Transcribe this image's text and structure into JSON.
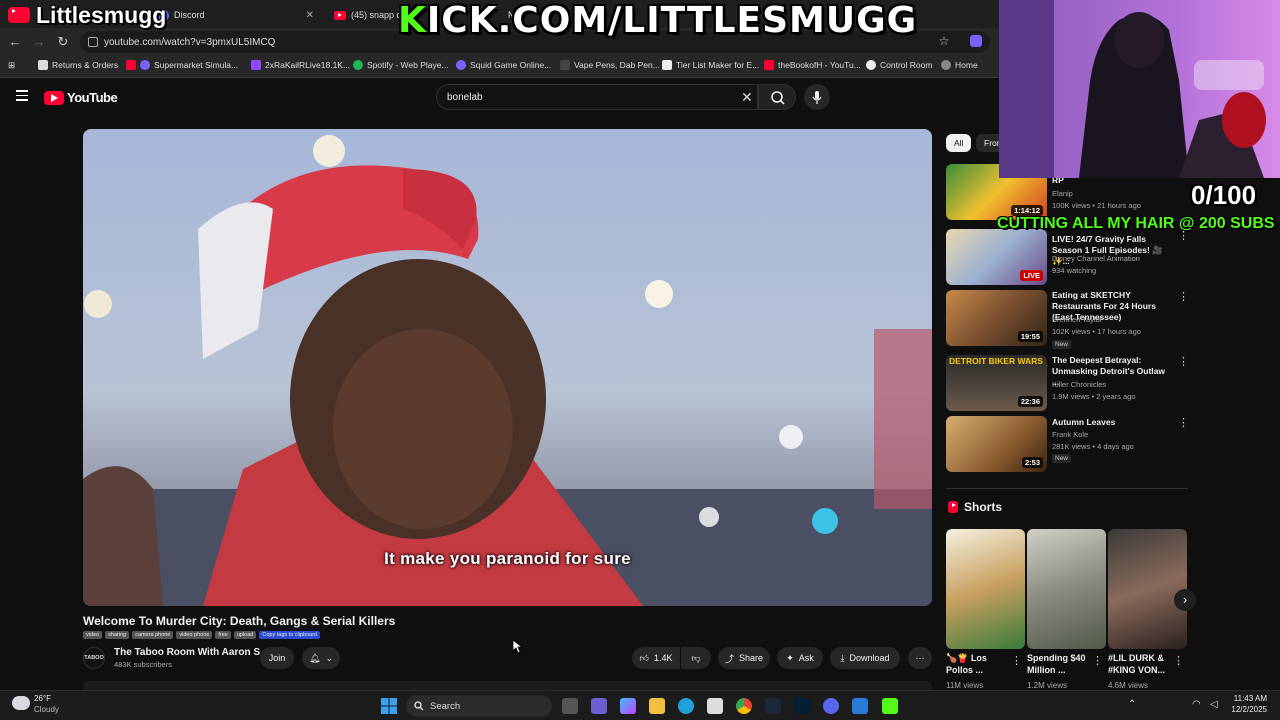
{
  "browser": {
    "tabs": [
      {
        "label": "(45) Littlesmugg"
      },
      {
        "label": "Discord"
      },
      {
        "label": "(45) snapp dog"
      },
      {
        "label": "New"
      }
    ],
    "url": "youtube.com/watch?v=3pmxUL5IMCQ",
    "bookmarks": [
      "Returns & Orders",
      "Supermarket Simula...",
      "2xRaKailRLive18.1K...",
      "Spotify - Web Playe...",
      "Squid Game Online...",
      "Vape Pens, Dab Pen...",
      "Tier List Maker for E...",
      "theBookofH - YouTu...",
      "Control Room",
      "Home"
    ]
  },
  "youtube": {
    "logo_text": "YouTube",
    "search_value": "bonelab"
  },
  "video": {
    "caption": "It make you paranoid for sure",
    "title": "Welcome To Murder City: Death, Gangs & Serial Killers",
    "tags": [
      "video",
      "sharing",
      "camera phone",
      "video phone",
      "free",
      "upload",
      "Copy tags to clipboard"
    ],
    "channel": {
      "avatar_text": "TABOO",
      "name": "The Taboo Room With Aaron S",
      "subscribers": "483K subscribers",
      "join_label": "Join"
    },
    "actions": {
      "likes": "1.4K",
      "share": "Share",
      "ask": "Ask",
      "download": "Download"
    }
  },
  "sidebar": {
    "chips": [
      "All",
      "From"
    ],
    "recommendations": [
      {
        "title": "$2,700,000 Bounty In GTA 5 RP",
        "channel": "Elanip",
        "meta": "100K views • 21 hours ago",
        "duration": "1:14:12",
        "badge": ""
      },
      {
        "title": "LIVE! 24/7 Gravity Falls Season 1 Full Episodes! 🎥 ✨...",
        "channel": "Disney Channel Animation",
        "meta": "934 watching",
        "duration": "LIVE",
        "badge": ""
      },
      {
        "title": "Eating at SKETCHY Restaurants For 24 Hours (East Tennessee)",
        "channel": "Brennen Taylor",
        "meta": "102K views • 17 hours ago",
        "duration": "19:55",
        "badge": "New"
      },
      {
        "title": "The Deepest Betrayal: Unmasking Detroit's Outlaw ...",
        "channel": "Killer Chronicles",
        "meta": "1.9M views • 2 years ago",
        "duration": "22:36",
        "badge": "",
        "thumb_text": "DETROIT BIKER WARS"
      },
      {
        "title": "Autumn Leaves",
        "channel": "Frank Kole",
        "meta": "281K views • 4 days ago",
        "duration": "2:53",
        "badge": "New"
      }
    ],
    "shorts_heading": "Shorts",
    "shorts": [
      {
        "title": "🍗🍟 Los Pollos ...",
        "views": "11M views"
      },
      {
        "title": "Spending $40 Million ...",
        "views": "1.2M views"
      },
      {
        "title": "#LIL DURK & #KING VON...",
        "views": "4.6M views"
      }
    ]
  },
  "stream_overlay": {
    "name": "Littlesmugg",
    "kick_url": "KICK.COM/LITTLESMUGG",
    "goal_count": "0/100",
    "goal_text": "CUTTING ALL MY HAIR @ 200 SUBS"
  },
  "taskbar": {
    "weather_temp": "26°F",
    "weather_desc": "Cloudy",
    "search_label": "Search",
    "time": "11:43 AM",
    "date": "12/2/2025"
  },
  "colors": {
    "youtube_red": "#ff0033",
    "kick_green": "#53fc18",
    "bg": "#0f0f0f"
  }
}
